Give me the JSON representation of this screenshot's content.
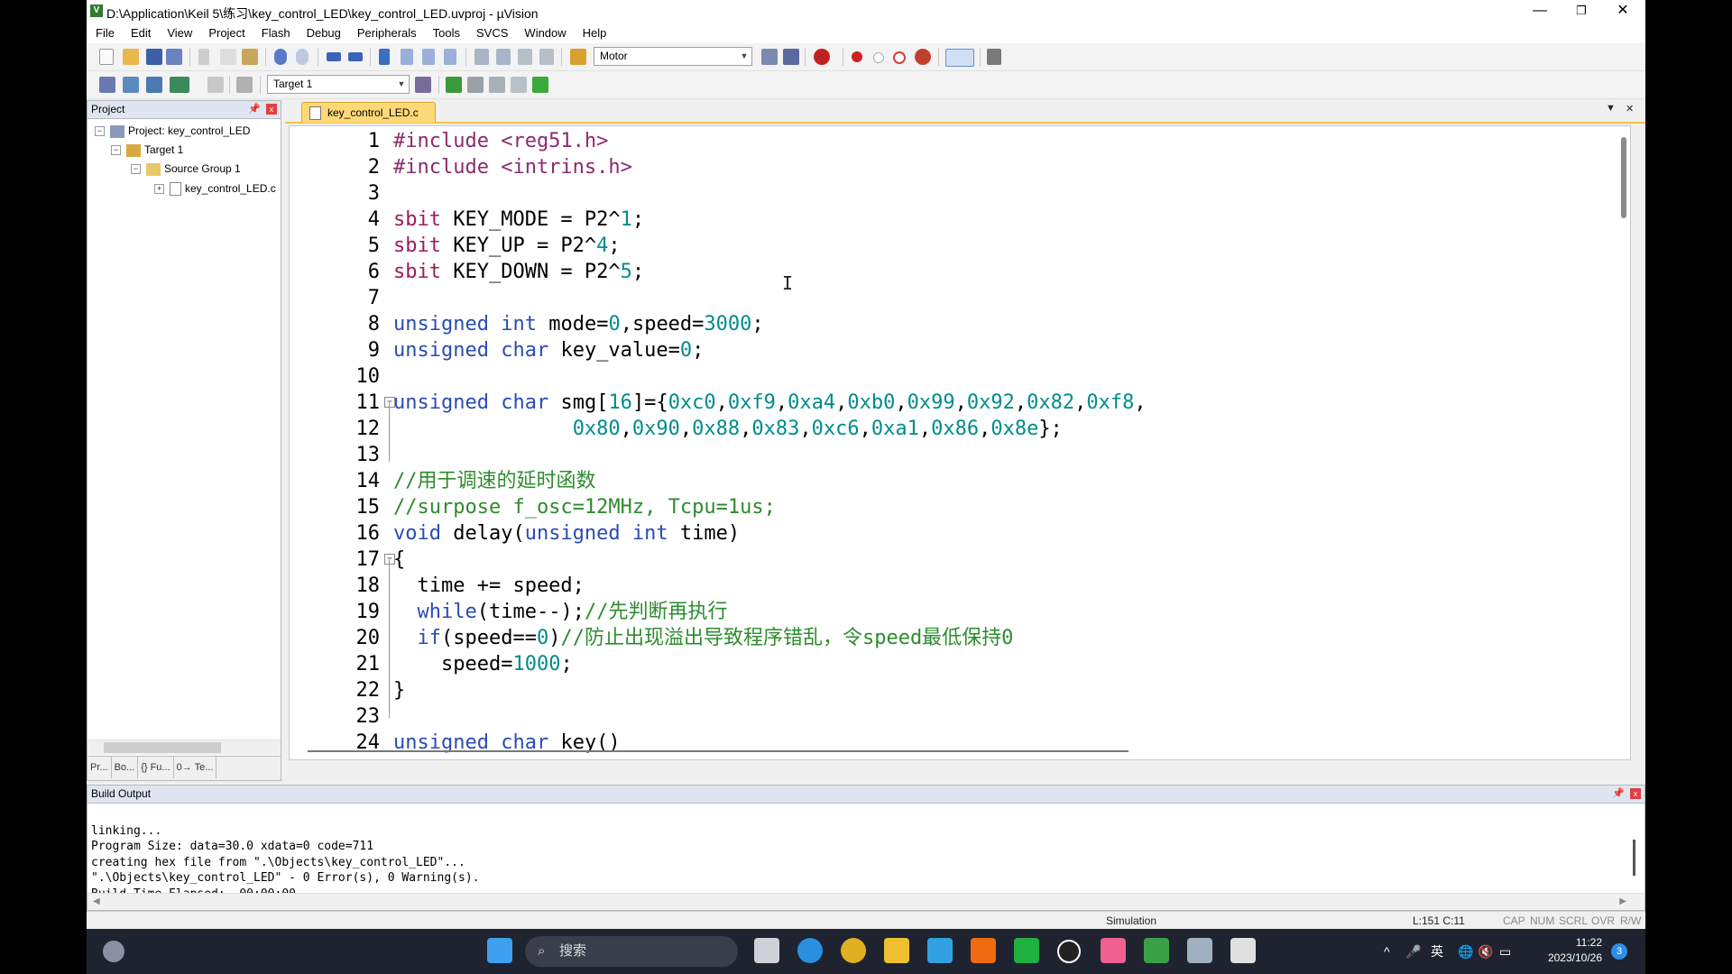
{
  "window": {
    "title": "D:\\Application\\Keil 5\\练习\\key_control_LED\\key_control_LED.uvproj - µVision",
    "minimize": "—",
    "restore": "❐",
    "close": "✕"
  },
  "menu": [
    "File",
    "Edit",
    "View",
    "Project",
    "Flash",
    "Debug",
    "Peripherals",
    "Tools",
    "SVCS",
    "Window",
    "Help"
  ],
  "toolbar": {
    "find_combo": "Motor",
    "target_combo": "Target 1"
  },
  "project_pane": {
    "header": "Project",
    "pin": "ᵖ",
    "close": "x",
    "tree": [
      {
        "label": "Project: key_control_LED",
        "expander": "−"
      },
      {
        "label": "Target 1",
        "expander": "−"
      },
      {
        "label": "Source Group 1",
        "expander": "−"
      },
      {
        "label": "key_control_LED.c",
        "expander": "+"
      }
    ],
    "tabs": [
      "Pr...",
      "Bo...",
      "{} Fu...",
      "0→ Te..."
    ]
  },
  "editor": {
    "file_tab": "key_control_LED.c",
    "tab_dropdown": "▼",
    "tab_close": "✕",
    "line_numbers": [
      "1",
      "2",
      "3",
      "4",
      "5",
      "6",
      "7",
      "8",
      "9",
      "10",
      "11",
      "12",
      "13",
      "14",
      "15",
      "16",
      "17",
      "18",
      "19",
      "20",
      "21",
      "22",
      "23",
      "24"
    ],
    "fold_markers": {
      "11": "−",
      "17": "−"
    }
  },
  "build_output": {
    "header": "Build Output",
    "lines": [
      "linking...",
      "Program Size: data=30.0 xdata=0 code=711",
      "creating hex file from \".\\Objects\\key_control_LED\"...",
      "\".\\Objects\\key_control_LED\" - 0 Error(s), 0 Warning(s).",
      "Build Time Elapsed:  00:00:00"
    ]
  },
  "status_bar": {
    "mode": "Simulation",
    "position": "L:151 C:11",
    "cap": "CAP",
    "num": "NUM",
    "scrl": "SCRL",
    "ovr": "OVR",
    "rw": "R/W"
  },
  "taskbar": {
    "search_placeholder": "搜索",
    "ime": "英",
    "time": "11:22",
    "date": "2023/10/26",
    "notifications": "3"
  }
}
